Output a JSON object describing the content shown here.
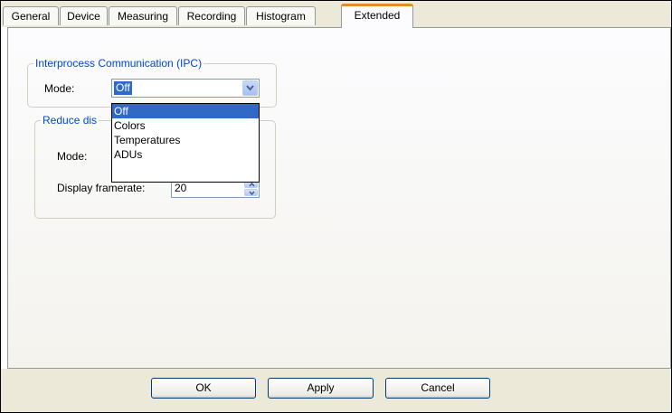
{
  "tabs": [
    {
      "label": "General"
    },
    {
      "label": "Device"
    },
    {
      "label": "Measuring"
    },
    {
      "label": "Recording"
    },
    {
      "label": "Histogram"
    },
    {
      "label": "Extended",
      "active": true
    }
  ],
  "ipc_group": {
    "title": "Interprocess Communication (IPC)",
    "mode_label": "Mode:",
    "mode_value": "Off",
    "options": [
      "Off",
      "Colors",
      "Temperatures",
      "ADUs"
    ],
    "selected_option": "Off"
  },
  "reduce_group": {
    "title_visible": "Reduce dis",
    "mode_label": "Mode:",
    "framerate_label": "Display framerate:",
    "framerate_value": "20"
  },
  "buttons": {
    "ok": "OK",
    "apply": "Apply",
    "cancel": "Cancel"
  },
  "colors": {
    "selection": "#316ac5",
    "group_title": "#0046d5",
    "tab_highlight": "#e68b2c"
  }
}
